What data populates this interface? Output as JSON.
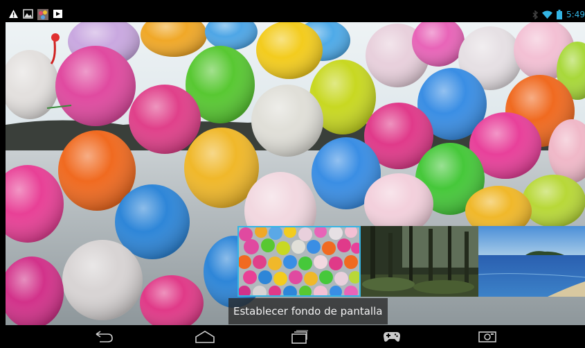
{
  "status_bar": {
    "left_icons": [
      "warning-icon",
      "image-icon",
      "photo-thumbnail-icon",
      "video-play-icon"
    ],
    "right_icons": [
      "bluetooth-icon",
      "wifi-icon",
      "battery-icon"
    ],
    "time": "5:49",
    "accent_color": "#33b5e5"
  },
  "wallpaper": {
    "subject": "colorful balloons over sea"
  },
  "picker": {
    "thumbnails": [
      {
        "id": "balloons",
        "selected": true
      },
      {
        "id": "forest",
        "selected": false
      },
      {
        "id": "sea",
        "selected": false
      }
    ],
    "action_label": "Establecer fondo de pantalla"
  },
  "nav_bar": {
    "buttons": [
      "back-icon",
      "home-icon",
      "recent-apps-icon",
      "gamepad-icon",
      "screenshot-icon"
    ]
  }
}
